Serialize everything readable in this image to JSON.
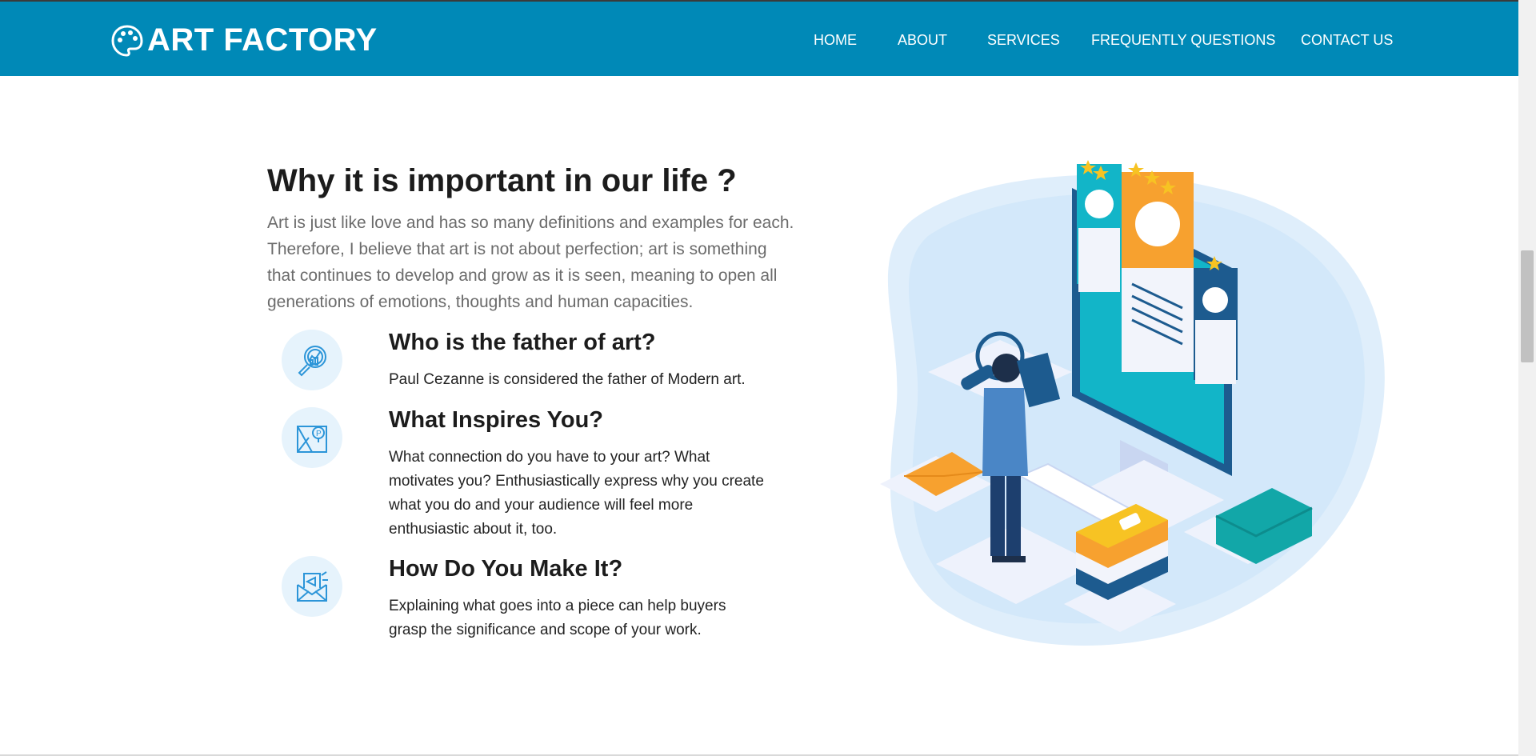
{
  "brand": {
    "name": "ART FACTORY",
    "icon": "palette-icon"
  },
  "nav": {
    "items": [
      {
        "label": "HOME"
      },
      {
        "label": "ABOUT"
      },
      {
        "label": "SERVICES"
      },
      {
        "label": "FREQUENTLY QUESTIONS"
      },
      {
        "label": "CONTACT US"
      }
    ]
  },
  "section": {
    "title": "Why it is important in our life ?",
    "intro": "Art is just like love and has so many definitions and examples for each. Therefore, I believe that art is not about perfection; art is something that continues to develop and grow as it is seen, meaning to open all generations of emotions, thoughts and human capacities.",
    "features": [
      {
        "icon": "chart-magnifier-icon",
        "title": "Who is the father of art?",
        "text": "Paul Cezanne is considered the father of Modern art."
      },
      {
        "icon": "map-pin-icon",
        "title": "What Inspires You?",
        "text": "What connection do you have to your art? What motivates you? Enthusiastically express why you create what you do and your audience will feel more enthusiastic about it, too."
      },
      {
        "icon": "megaphone-mail-icon",
        "title": "How Do You Make It?",
        "text": "Explaining what goes into a piece can help buyers grasp the significance and scope of your work."
      }
    ]
  },
  "illustration": {
    "icon": "isometric-workspace-illustration"
  },
  "colors": {
    "navbar": "#0089b7",
    "icon_bg": "#e6f3fc",
    "icon_stroke": "#2c95d8",
    "accent_orange": "#f7a12f",
    "accent_teal": "#12b5c8"
  }
}
